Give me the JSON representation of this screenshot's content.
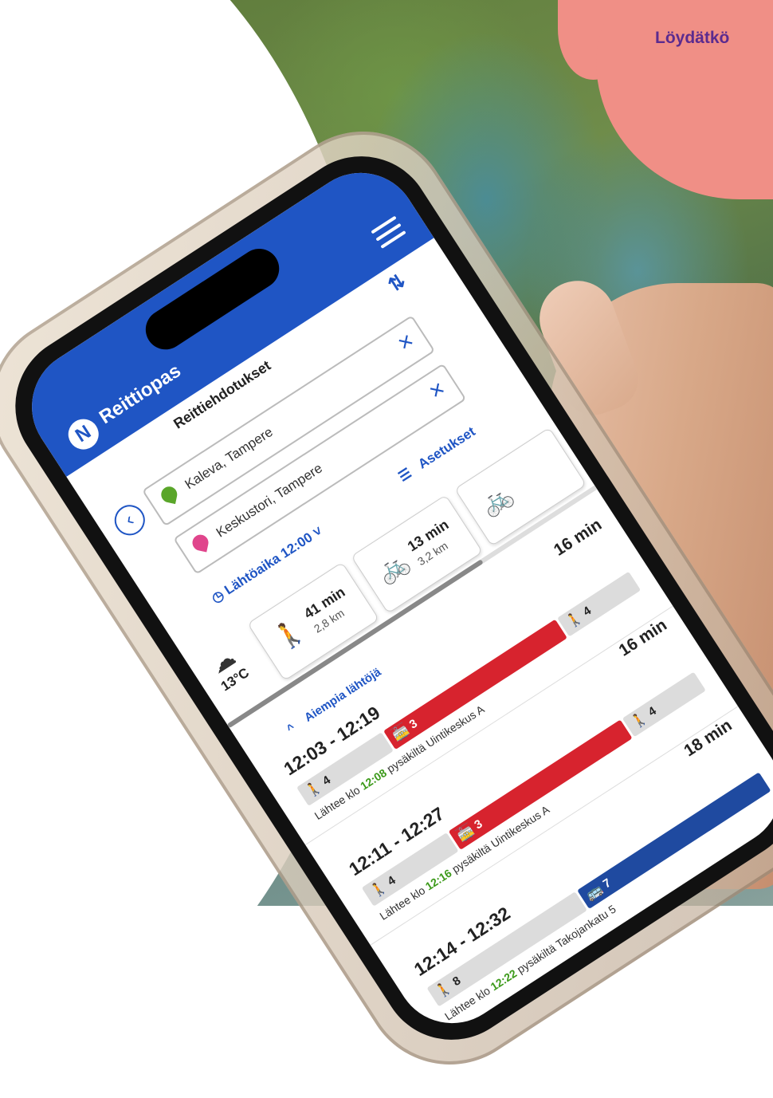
{
  "banner": {
    "headline": "Löydätkö"
  },
  "app": {
    "title": "Reittiopas",
    "logo_letter": "N"
  },
  "page": {
    "title": "Reittiehdotukset"
  },
  "search": {
    "origin": "Kaleva, Tampere",
    "destination": "Keskustori, Tampere",
    "departure_label": "Lähtöaika 12:00",
    "settings_label": "Asetukset"
  },
  "modes": [
    {
      "icon": "walk-icon",
      "time": "41 min",
      "distance": "2,8 km"
    },
    {
      "icon": "bike-icon",
      "time": "13 min",
      "distance": "3,2 km"
    }
  ],
  "weather": {
    "icon": "rain-cloud-icon",
    "temp": "13°C"
  },
  "earlier_label": "Aiempia lähtöjä",
  "routes": [
    {
      "duration": "16 min",
      "times": "12:03 - 12:19",
      "segments": [
        {
          "type": "walk",
          "label": "4",
          "share": 0.26
        },
        {
          "type": "tram",
          "label": "3",
          "share": 0.52,
          "color": "#d7232e"
        },
        {
          "type": "walk",
          "label": "4",
          "share": 0.22
        }
      ],
      "leaves_prefix": "Lähtee klo",
      "leaves_time": "12:08",
      "leaves_suffix": "pysäkiltä Uintikeskus A"
    },
    {
      "duration": "16 min",
      "times": "12:11 - 12:27",
      "segments": [
        {
          "type": "walk",
          "label": "4",
          "share": 0.26
        },
        {
          "type": "tram",
          "label": "3",
          "share": 0.52,
          "color": "#d7232e"
        },
        {
          "type": "walk",
          "label": "4",
          "share": 0.22
        }
      ],
      "leaves_prefix": "Lähtee klo",
      "leaves_time": "12:16",
      "leaves_suffix": "pysäkiltä Uintikeskus A"
    },
    {
      "duration": "18 min",
      "times": "12:14 - 12:32",
      "segments": [
        {
          "type": "walk",
          "label": "8",
          "share": 0.45
        },
        {
          "type": "bus",
          "label": "7",
          "share": 0.55,
          "color": "#1f4aa0"
        }
      ],
      "leaves_prefix": "Lähtee klo",
      "leaves_time": "12:22",
      "leaves_suffix": "pysäkiltä Takojankatu 5"
    }
  ],
  "colors": {
    "brand": "#1f55c4",
    "tram": "#d7232e",
    "bus": "#1f4aa0",
    "time_green": "#3c9a1a",
    "banner": "#f08f86",
    "headline": "#5b2b8f"
  }
}
